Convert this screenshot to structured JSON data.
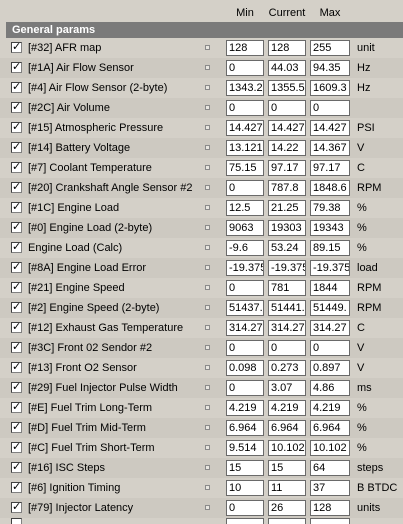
{
  "header": {
    "min_label": "Min",
    "current_label": "Current",
    "max_label": "Max"
  },
  "section_title": "General params",
  "rows": [
    {
      "checked": true,
      "name": "[#32] AFR map",
      "min": "128",
      "current": "128",
      "max": "255",
      "unit": "unit"
    },
    {
      "checked": true,
      "name": "[#1A] Air Flow Sensor",
      "min": "0",
      "current": "44.03",
      "max": "94.35",
      "unit": "Hz"
    },
    {
      "checked": true,
      "name": "[#4] Air Flow Sensor (2-byte)",
      "min": "1343.2",
      "current": "1355.5",
      "max": "1609.3",
      "unit": "Hz"
    },
    {
      "checked": true,
      "name": "[#2C] Air Volume",
      "min": "0",
      "current": "0",
      "max": "0",
      "unit": ""
    },
    {
      "checked": true,
      "name": "[#15] Atmospheric Pressure",
      "min": "14.427",
      "current": "14.427",
      "max": "14.427",
      "unit": "PSI"
    },
    {
      "checked": true,
      "name": "[#14] Battery Voltage",
      "min": "13.121",
      "current": "14.22",
      "max": "14.367",
      "unit": "V"
    },
    {
      "checked": true,
      "name": "[#7] Coolant Temperature",
      "min": "75.15",
      "current": "97.17",
      "max": "97.17",
      "unit": "C"
    },
    {
      "checked": true,
      "name": "[#20] Crankshaft Angle Sensor #2",
      "min": "0",
      "current": "787.8",
      "max": "1848.6",
      "unit": "RPM"
    },
    {
      "checked": true,
      "name": "[#1C] Engine Load",
      "min": "12.5",
      "current": "21.25",
      "max": "79.38",
      "unit": "%"
    },
    {
      "checked": true,
      "name": "[#0] Engine Load (2-byte)",
      "min": "9063",
      "current": "19303",
      "max": "19343",
      "unit": "%"
    },
    {
      "checked": true,
      "name": "Engine Load (Calc)",
      "min": "-9.6",
      "current": "53.24",
      "max": "89.15",
      "unit": "%"
    },
    {
      "checked": true,
      "name": "[#8A] Engine Load Error",
      "min": "-19.375",
      "current": "-19.375",
      "max": "-19.375",
      "unit": "load"
    },
    {
      "checked": true,
      "name": "[#21] Engine Speed",
      "min": "0",
      "current": "781",
      "max": "1844",
      "unit": "RPM"
    },
    {
      "checked": true,
      "name": "[#2] Engine Speed (2-byte)",
      "min": "51437.",
      "current": "51441.",
      "max": "51449.",
      "unit": "RPM"
    },
    {
      "checked": true,
      "name": "[#12] Exhaust Gas Temperature",
      "min": "314.27",
      "current": "314.27",
      "max": "314.27",
      "unit": "C"
    },
    {
      "checked": true,
      "name": "[#3C] Front 02 Sendor #2",
      "min": "0",
      "current": "0",
      "max": "0",
      "unit": "V"
    },
    {
      "checked": true,
      "name": "[#13] Front O2 Sensor",
      "min": "0.098",
      "current": "0.273",
      "max": "0.897",
      "unit": "V"
    },
    {
      "checked": true,
      "name": "[#29] Fuel Injector Pulse Width",
      "min": "0",
      "current": "3.07",
      "max": "4.86",
      "unit": "ms"
    },
    {
      "checked": true,
      "name": "[#E] Fuel Trim Long-Term",
      "min": "4.219",
      "current": "4.219",
      "max": "4.219",
      "unit": "%"
    },
    {
      "checked": true,
      "name": "[#D] Fuel Trim Mid-Term",
      "min": "6.964",
      "current": "6.964",
      "max": "6.964",
      "unit": "%"
    },
    {
      "checked": true,
      "name": "[#C] Fuel Trim Short-Term",
      "min": "9.514",
      "current": "10.102",
      "max": "10.102",
      "unit": "%"
    },
    {
      "checked": true,
      "name": "[#16] ISC Steps",
      "min": "15",
      "current": "15",
      "max": "64",
      "unit": "steps"
    },
    {
      "checked": true,
      "name": "[#6] Ignition Timing",
      "min": "10",
      "current": "11",
      "max": "37",
      "unit": "B BTDC"
    },
    {
      "checked": true,
      "name": "[#79] Injector Latency",
      "min": "0",
      "current": "26",
      "max": "128",
      "unit": "units"
    }
  ]
}
